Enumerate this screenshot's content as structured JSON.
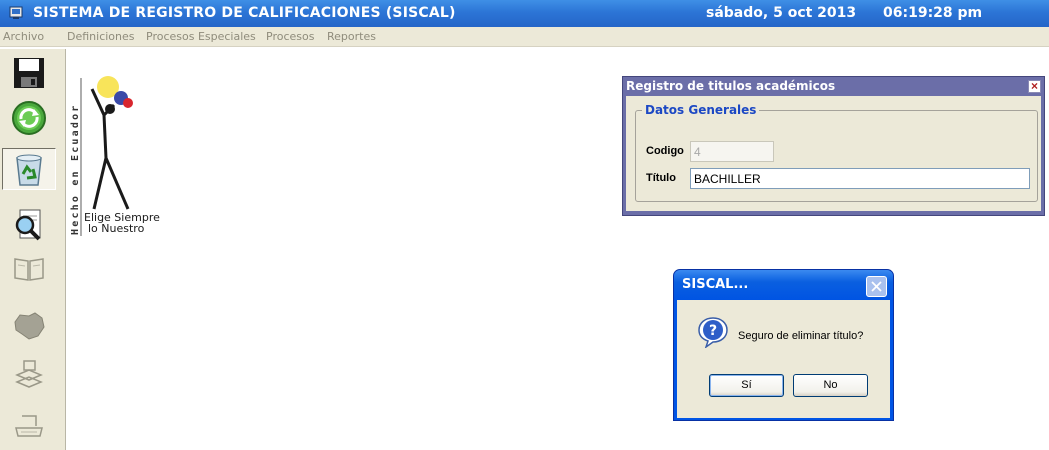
{
  "titlebar": {
    "title": "SISTEMA DE REGISTRO DE CALIFICACIONES   (SISCAL)",
    "date": "sábado, 5 oct 2013",
    "time": "06:19:28 pm"
  },
  "menu": [
    "Archivo",
    "Definiciones",
    "Procesos Especiales",
    "Procesos",
    "Reportes"
  ],
  "toolbar": [
    {
      "name": "save",
      "icon": "floppy-disk-icon",
      "enabled": true
    },
    {
      "name": "refresh",
      "icon": "green-refresh-icon",
      "enabled": true
    },
    {
      "name": "delete",
      "icon": "recycle-bin-icon",
      "enabled": true
    },
    {
      "name": "search",
      "icon": "magnifier-document-icon",
      "enabled": true
    },
    {
      "name": "book",
      "icon": "book-icon",
      "enabled": false
    },
    {
      "name": "map",
      "icon": "ecuador-map-icon",
      "enabled": false
    },
    {
      "name": "report",
      "icon": "report-icon",
      "enabled": false
    },
    {
      "name": "print",
      "icon": "printer-icon",
      "enabled": false
    }
  ],
  "logo": {
    "vertical_text": "Hecho en Ecuador",
    "slogan_line1": "Elige Siempre",
    "slogan_line2": "lo Nuestro"
  },
  "registro_window": {
    "title": "Registro de titulos académicos",
    "group_title": "Datos Generales",
    "codigo_label": "Codigo",
    "codigo_value": "4",
    "titulo_label": "Título",
    "titulo_value": "BACHILLER"
  },
  "dialog": {
    "title": "SISCAL...",
    "message": "Seguro de eliminar título?",
    "yes_label": "Sí",
    "no_label": "No"
  },
  "colors": {
    "titlebar": "#2c75d6",
    "window_title": "#6b6ea8",
    "group_title": "#1c48c4",
    "dialog_frame": "#0055e5"
  }
}
